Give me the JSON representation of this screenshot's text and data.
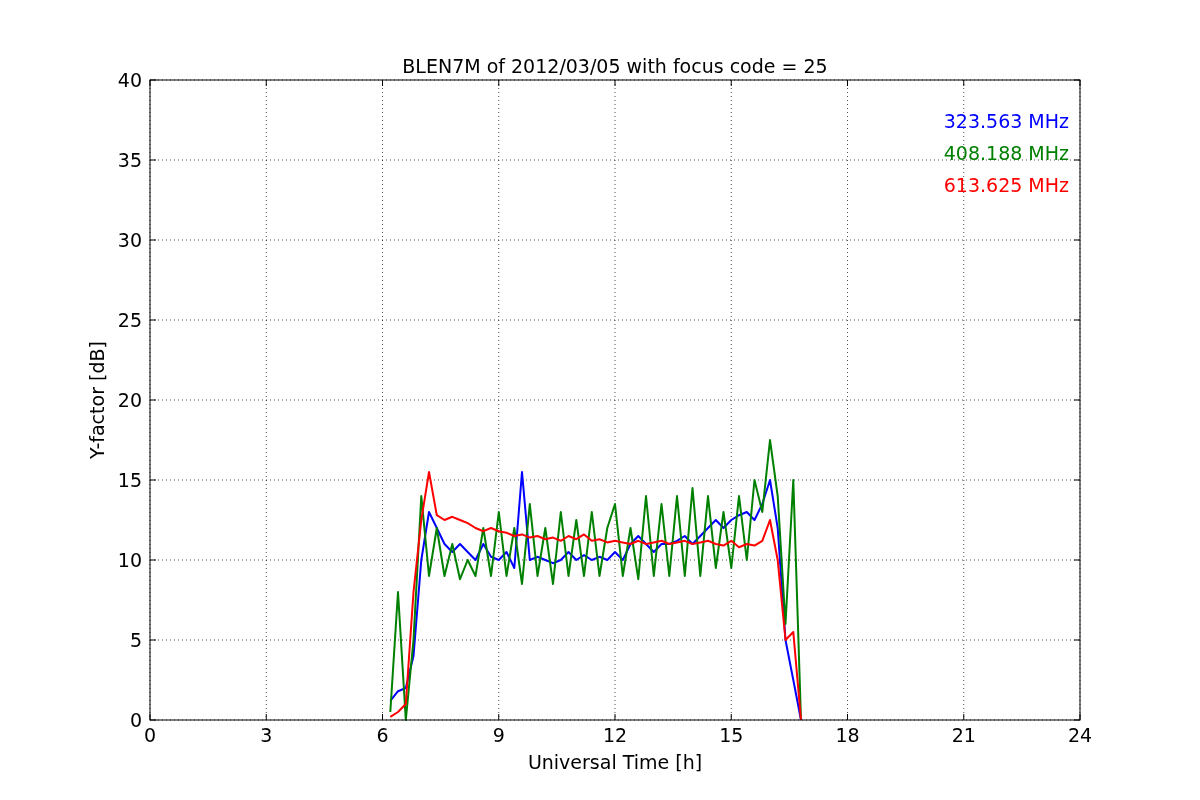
{
  "figure": {
    "chart_data": {
      "type": "line",
      "title": "BLEN7M of 2012/03/05 with focus code = 25",
      "xlabel": "Universal Time [h]",
      "ylabel": "Y-factor [dB]",
      "x": [
        6.2,
        6.4,
        6.6,
        6.8,
        7.0,
        7.2,
        7.4,
        7.6,
        7.8,
        8.0,
        8.2,
        8.4,
        8.6,
        8.8,
        9.0,
        9.2,
        9.4,
        9.6,
        9.8,
        10.0,
        10.2,
        10.4,
        10.6,
        10.8,
        11.0,
        11.2,
        11.4,
        11.6,
        11.8,
        12.0,
        12.2,
        12.4,
        12.6,
        12.8,
        13.0,
        13.2,
        13.4,
        13.6,
        13.8,
        14.0,
        14.2,
        14.4,
        14.6,
        14.8,
        15.0,
        15.2,
        15.4,
        15.6,
        15.8,
        16.0,
        16.2,
        16.4,
        16.6,
        16.8
      ],
      "series": [
        {
          "name": "323.563 MHz",
          "color": "#0000ff",
          "values": [
            1.2,
            1.8,
            2.0,
            4,
            10,
            13,
            12,
            11,
            10.5,
            11,
            10.5,
            10,
            11,
            10.2,
            10,
            10.5,
            9.5,
            15.5,
            10,
            10.2,
            10,
            9.8,
            10,
            10.5,
            10,
            10.3,
            10,
            10.2,
            10,
            10.5,
            10,
            11,
            11.5,
            11,
            10.5,
            11,
            11,
            11.2,
            11.5,
            11,
            11.5,
            12,
            12.5,
            12,
            12.5,
            12.8,
            13,
            12.5,
            13.5,
            15,
            12,
            5,
            2.5,
            0
          ]
        },
        {
          "name": "408.188 MHz",
          "color": "#008000",
          "values": [
            0.5,
            8,
            0,
            5,
            14,
            9,
            12,
            9,
            11,
            8.8,
            10,
            9,
            12,
            9,
            13,
            9,
            12,
            8.5,
            13.5,
            9,
            12,
            8.5,
            13,
            9,
            12.5,
            9,
            13,
            9,
            12,
            13.5,
            9,
            12,
            8.8,
            14,
            9,
            13.5,
            9,
            14,
            9,
            14.5,
            9,
            14,
            9.5,
            13,
            9.5,
            14,
            10,
            15,
            13,
            17.5,
            14,
            6,
            15,
            0
          ]
        },
        {
          "name": "613.625 MHz",
          "color": "#ff0000",
          "values": [
            0.2,
            0.5,
            1,
            8,
            12.5,
            15.5,
            12.8,
            12.5,
            12.7,
            12.5,
            12.3,
            12,
            11.8,
            12,
            11.8,
            11.7,
            11.5,
            11.6,
            11.4,
            11.5,
            11.3,
            11.4,
            11.2,
            11.5,
            11.3,
            11.6,
            11.2,
            11.3,
            11.1,
            11.2,
            11.1,
            11,
            11.2,
            11,
            11.1,
            11.2,
            11,
            11.1,
            11.2,
            11,
            11.1,
            11.2,
            11,
            10.9,
            11.2,
            10.8,
            11,
            10.9,
            11.2,
            12.5,
            10,
            5,
            5.5,
            0
          ]
        }
      ],
      "grid": true,
      "xlim": [
        0,
        24
      ],
      "ylim": [
        0,
        40
      ],
      "xticks": [
        0,
        3,
        6,
        9,
        12,
        15,
        18,
        21,
        24
      ],
      "yticks": [
        0,
        5,
        10,
        15,
        20,
        25,
        30,
        35,
        40
      ]
    }
  }
}
